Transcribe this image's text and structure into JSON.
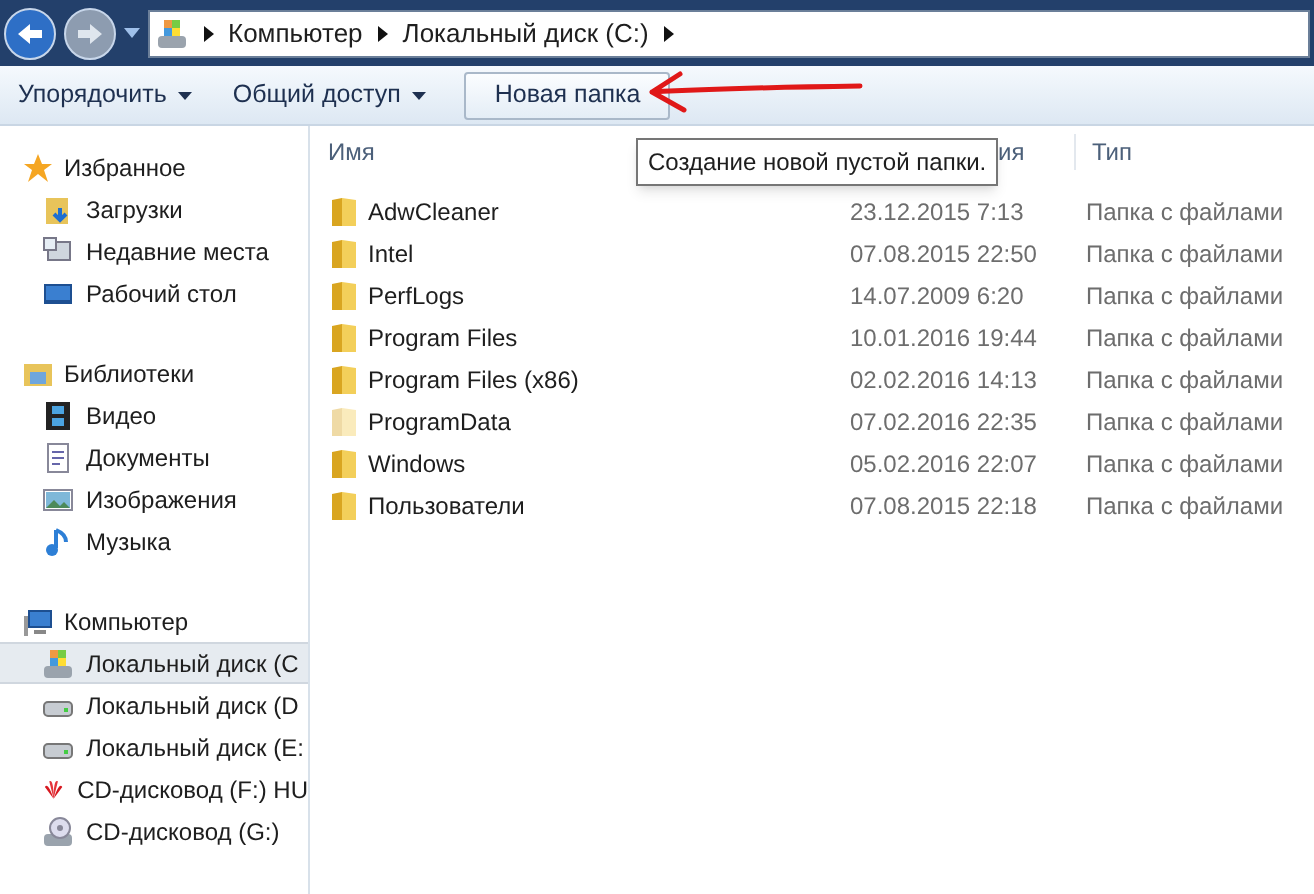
{
  "address_bar": {
    "crumbs": [
      "Компьютер",
      "Локальный диск (C:)"
    ]
  },
  "toolbar": {
    "buttons": [
      {
        "label": "Упорядочить",
        "dropdown": true
      },
      {
        "label": "Общий доступ",
        "dropdown": true
      },
      {
        "label": "Новая папка",
        "dropdown": false
      }
    ]
  },
  "tooltip": "Создание новой пустой папки.",
  "sidebar": {
    "groups": [
      {
        "label": "Избранное",
        "kind": "favorites",
        "items": [
          {
            "label": "Загрузки",
            "kind": "download",
            "selected": false
          },
          {
            "label": "Недавние места",
            "kind": "recent",
            "selected": false
          },
          {
            "label": "Рабочий стол",
            "kind": "desktop",
            "selected": false
          }
        ]
      },
      {
        "label": "Библиотеки",
        "kind": "library",
        "items": [
          {
            "label": "Видео",
            "kind": "video",
            "selected": false
          },
          {
            "label": "Документы",
            "kind": "doc",
            "selected": false
          },
          {
            "label": "Изображения",
            "kind": "image",
            "selected": false
          },
          {
            "label": "Музыка",
            "kind": "music",
            "selected": false
          }
        ]
      },
      {
        "label": "Компьютер",
        "kind": "computer",
        "items": [
          {
            "label": "Локальный диск (C",
            "kind": "sysdrive",
            "selected": true
          },
          {
            "label": "Локальный диск (D",
            "kind": "drive",
            "selected": false
          },
          {
            "label": "Локальный диск (E:",
            "kind": "drive",
            "selected": false
          },
          {
            "label": "CD-дисковод (F:) HU",
            "kind": "cdbrand",
            "selected": false
          },
          {
            "label": "CD-дисковод (G:)",
            "kind": "cd",
            "selected": false
          }
        ]
      }
    ]
  },
  "table": {
    "columns": [
      "Имя",
      "ия",
      "Тип"
    ],
    "rows": [
      {
        "name": "AdwCleaner",
        "date": "23.12.2015 7:13",
        "type": "Папка с файлами",
        "hidden": false
      },
      {
        "name": "Intel",
        "date": "07.08.2015 22:50",
        "type": "Папка с файлами",
        "hidden": false
      },
      {
        "name": "PerfLogs",
        "date": "14.07.2009 6:20",
        "type": "Папка с файлами",
        "hidden": false
      },
      {
        "name": "Program Files",
        "date": "10.01.2016 19:44",
        "type": "Папка с файлами",
        "hidden": false
      },
      {
        "name": "Program Files (x86)",
        "date": "02.02.2016 14:13",
        "type": "Папка с файлами",
        "hidden": false
      },
      {
        "name": "ProgramData",
        "date": "07.02.2016 22:35",
        "type": "Папка с файлами",
        "hidden": true
      },
      {
        "name": "Windows",
        "date": "05.02.2016 22:07",
        "type": "Папка с файлами",
        "hidden": false
      },
      {
        "name": "Пользователи",
        "date": "07.08.2015 22:18",
        "type": "Папка с файлами",
        "hidden": false
      }
    ]
  }
}
